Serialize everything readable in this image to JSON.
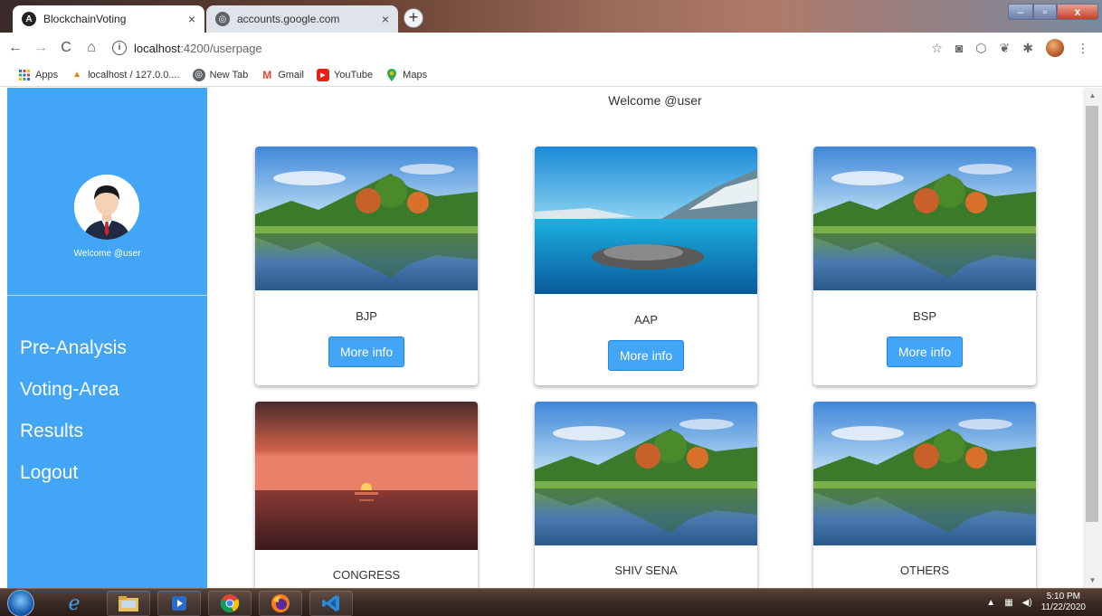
{
  "browser": {
    "tabs": [
      {
        "title": "BlockchainVoting",
        "active": true
      },
      {
        "title": "accounts.google.com",
        "active": false
      }
    ],
    "close_glyph": "×",
    "new_tab_glyph": "+",
    "address": {
      "host": "localhost",
      "path": ":4200/userpage"
    },
    "bookmarks": [
      {
        "label": "Apps",
        "icon": "apps-grid-icon"
      },
      {
        "label": "localhost / 127.0.0....",
        "icon": "phpmyadmin-icon"
      },
      {
        "label": "New Tab",
        "icon": "globe-icon"
      },
      {
        "label": "Gmail",
        "icon": "gmail-icon"
      },
      {
        "label": "YouTube",
        "icon": "youtube-icon"
      },
      {
        "label": "Maps",
        "icon": "maps-pin-icon"
      }
    ]
  },
  "sidebar": {
    "welcome": "Welcome @user",
    "menu": [
      {
        "label": "Pre-Analysis"
      },
      {
        "label": "Voting-Area"
      },
      {
        "label": "Results"
      },
      {
        "label": "Logout"
      }
    ],
    "color": "#42a5f5"
  },
  "main": {
    "welcome": "Welcome @user",
    "button_label": "More info",
    "parties": [
      {
        "name": "BJP",
        "image": "lake-autumn-trees"
      },
      {
        "name": "AAP",
        "image": "blue-lake-rock"
      },
      {
        "name": "BSP",
        "image": "lake-autumn-trees"
      },
      {
        "name": "CONGRESS",
        "image": "sea-sunset"
      },
      {
        "name": "SHIV SENA",
        "image": "lake-autumn-trees"
      },
      {
        "name": "OTHERS",
        "image": "lake-autumn-trees"
      }
    ]
  },
  "taskbar": {
    "time": "5:10 PM",
    "date": "11/22/2020",
    "apps": [
      "internet-explorer-icon",
      "file-explorer-icon",
      "media-player-icon",
      "chrome-icon",
      "firefox-icon",
      "vscode-icon"
    ]
  }
}
